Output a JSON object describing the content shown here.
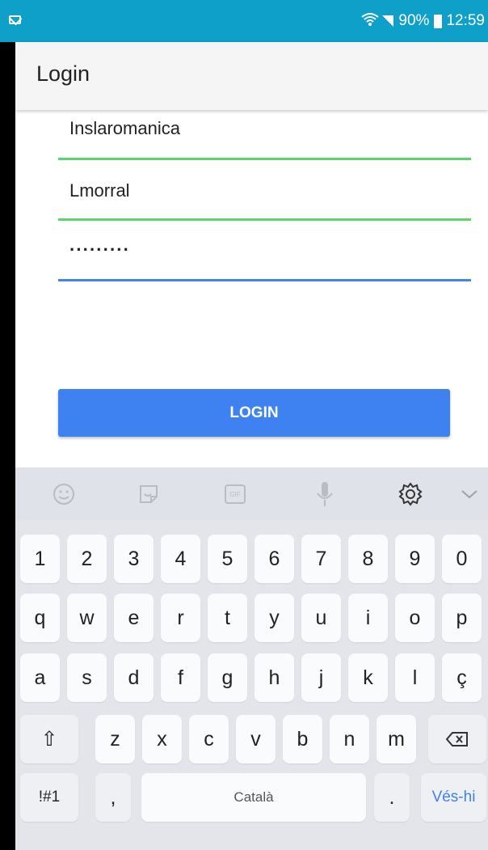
{
  "status_bar": {
    "battery": "90%",
    "time": "12:59"
  },
  "app_bar": {
    "title": "Login"
  },
  "form": {
    "fields": [
      {
        "name": "inslaromanica-field",
        "value": "Inslaromanica"
      },
      {
        "name": "username-field",
        "value": "Lmorral"
      },
      {
        "name": "password-field",
        "value": "·········"
      }
    ],
    "login_label": "LOGIN"
  },
  "keyboard": {
    "toolbar_icons": [
      "emoji-icon",
      "sticker-icon",
      "gif-icon",
      "mic-icon",
      "gear-icon",
      "chevron-down-icon"
    ],
    "row_numbers": [
      "1",
      "2",
      "3",
      "4",
      "5",
      "6",
      "7",
      "8",
      "9",
      "0"
    ],
    "row_q": [
      "q",
      "w",
      "e",
      "r",
      "t",
      "y",
      "u",
      "i",
      "o",
      "p"
    ],
    "row_a": [
      "a",
      "s",
      "d",
      "f",
      "g",
      "h",
      "j",
      "k",
      "l",
      "ç"
    ],
    "row_z": [
      "z",
      "x",
      "c",
      "v",
      "b",
      "n",
      "m"
    ],
    "symbols_label": "!#1",
    "comma_label": ",",
    "space_label": "Català",
    "period_label": ".",
    "enter_label": "Vés-hi",
    "shift_symbol": "⇧"
  }
}
